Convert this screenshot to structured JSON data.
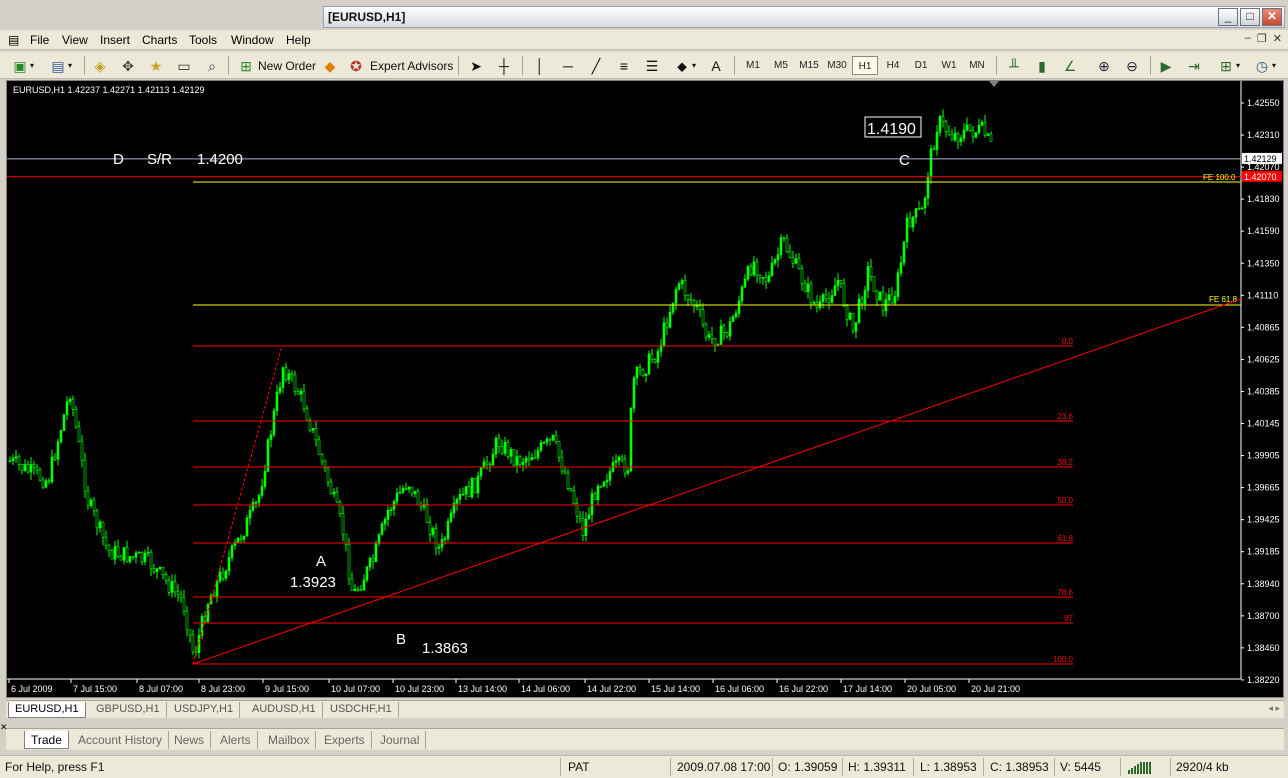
{
  "window": {
    "title": "[EURUSD,H1]",
    "minimize": "_",
    "maximize": "□",
    "close": "✕"
  },
  "menu": [
    "File",
    "View",
    "Insert",
    "Charts",
    "Tools",
    "Window",
    "Help"
  ],
  "toolbar": {
    "new_order": "New Order",
    "expert_advisors": "Expert Advisors",
    "text_tool": "A",
    "timeframes": [
      "M1",
      "M5",
      "M15",
      "M30",
      "H1",
      "H4",
      "D1",
      "W1",
      "MN"
    ],
    "active_timeframe": "H1"
  },
  "chart": {
    "header": "EURUSD,H1  1.42237 1.42271 1.42113 1.42129",
    "current_price": "1.42129",
    "red_level_price": "1.42070",
    "price_labels": [
      "1.42550",
      "1.42310",
      "1.42070",
      "1.41830",
      "1.41590",
      "1.41350",
      "1.41110",
      "1.40865",
      "1.40625",
      "1.40385",
      "1.40145",
      "1.39905",
      "1.39665",
      "1.39425",
      "1.39185",
      "1.38940",
      "1.38700",
      "1.38460",
      "1.38220"
    ],
    "time_labels": [
      "6 Jul 2009",
      "7 Jul 15:00",
      "8 Jul 07:00",
      "8 Jul 23:00",
      "9 Jul 15:00",
      "10 Jul 07:00",
      "10 Jul 23:00",
      "13 Jul 14:00",
      "14 Jul 06:00",
      "14 Jul 22:00",
      "15 Jul 14:00",
      "16 Jul 06:00",
      "16 Jul 22:00",
      "17 Jul 14:00",
      "20 Jul 05:00",
      "20 Jul 21:00"
    ],
    "fib_levels": [
      "0.0",
      "23.6",
      "38.2",
      "50.0",
      "61.8",
      "78.6",
      "87",
      "100.0"
    ],
    "fe_levels": [
      "FE 100.0",
      "FE 61.8"
    ],
    "annotations": {
      "d": "D",
      "sr": "S/R",
      "sr_price": "1.4200",
      "c": "C",
      "c_price": "1.4190",
      "a": "A",
      "a_price": "1.3923",
      "b": "B",
      "b_price": "1.3863"
    },
    "colors": {
      "background": "#000000",
      "candles": "#00ff00",
      "levels": "#ff0000",
      "fe": "#ffff00",
      "price_line": "#b0b8d0"
    }
  },
  "symbol_tabs": [
    "EURUSD,H1",
    "GBPUSD,H1",
    "USDJPY,H1",
    "AUDUSD,H1",
    "USDCHF,H1"
  ],
  "terminal_tabs": [
    "Trade",
    "Account History",
    "News",
    "Alerts",
    "Mailbox",
    "Experts",
    "Journal"
  ],
  "status": {
    "help": "For Help, press F1",
    "profile": "PAT",
    "datetime": "2009.07.08 17:00",
    "open": "O: 1.39059",
    "high": "H: 1.39311",
    "low": "L: 1.38953",
    "close": "C: 1.38953",
    "volume": "V: 5445",
    "traffic": "2920/4 kb"
  }
}
